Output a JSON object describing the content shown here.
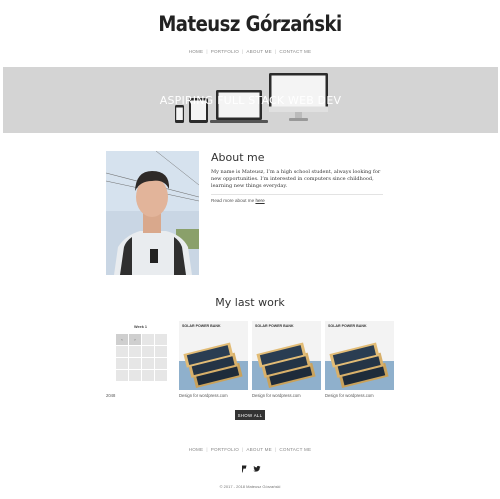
{
  "site": {
    "brand": "Mateusz Górzański"
  },
  "nav": {
    "items": [
      "HOME",
      "PORTFOLIO",
      "ABOUT ME",
      "CONTACT ME"
    ],
    "separator": "|"
  },
  "hero": {
    "title": "ASPIRING FULL STACK WEB DEV",
    "background": "#d4d4d4"
  },
  "about": {
    "title": "About me",
    "text": "My name is Mateusz, I’m a high school student, always looking for new opportunities. I’m interested in computers since childhood, learning new things everyday.",
    "read_more_prefix": "Read more about me",
    "read_more_link": "here"
  },
  "work": {
    "title": "My last work",
    "calendar": {
      "title": "Week 1",
      "prev": "‹",
      "next": "›"
    },
    "items": [
      {
        "caption": "2048",
        "thumb_title": ""
      },
      {
        "caption": "Design for wordpress.com",
        "thumb_title": "SOLAR POWER BANK"
      },
      {
        "caption": "Design for wordpress.com",
        "thumb_title": "SOLAR POWER BANK"
      },
      {
        "caption": "Design for wordpress.com",
        "thumb_title": "SOLAR POWER BANK"
      }
    ],
    "show_all": "SHOW ALL"
  },
  "footer": {
    "nav_items": [
      "HOME",
      "PORTFOLIO",
      "ABOUT ME",
      "CONTACT ME"
    ],
    "social": [
      "foursquare-icon",
      "twitter-icon"
    ],
    "copyright": "© 2017 - 2018 Mateusz Górzański"
  }
}
